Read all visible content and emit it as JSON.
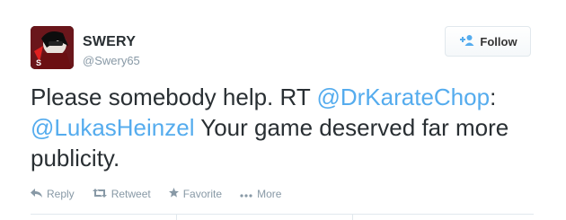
{
  "header": {
    "display_name": "SWERY",
    "handle": "@Swery65",
    "follow_label": "Follow"
  },
  "tweet": {
    "text_1": "Please somebody help. RT",
    "mention_1": "@DrKarateChop",
    "text_2": ": ",
    "mention_2": "@LukasHeinzel",
    "text_3": " Your game deserved far more publicity."
  },
  "actions": {
    "reply": "Reply",
    "retweet": "Retweet",
    "favorite": "Favorite",
    "more": "More"
  },
  "icons": {
    "follow": "add-user-icon",
    "reply": "reply-icon",
    "retweet": "retweet-icon",
    "favorite": "star-icon",
    "more": "ellipsis-icon"
  },
  "colors": {
    "link": "#55acee",
    "muted": "#8899a6",
    "text": "#292f33"
  }
}
